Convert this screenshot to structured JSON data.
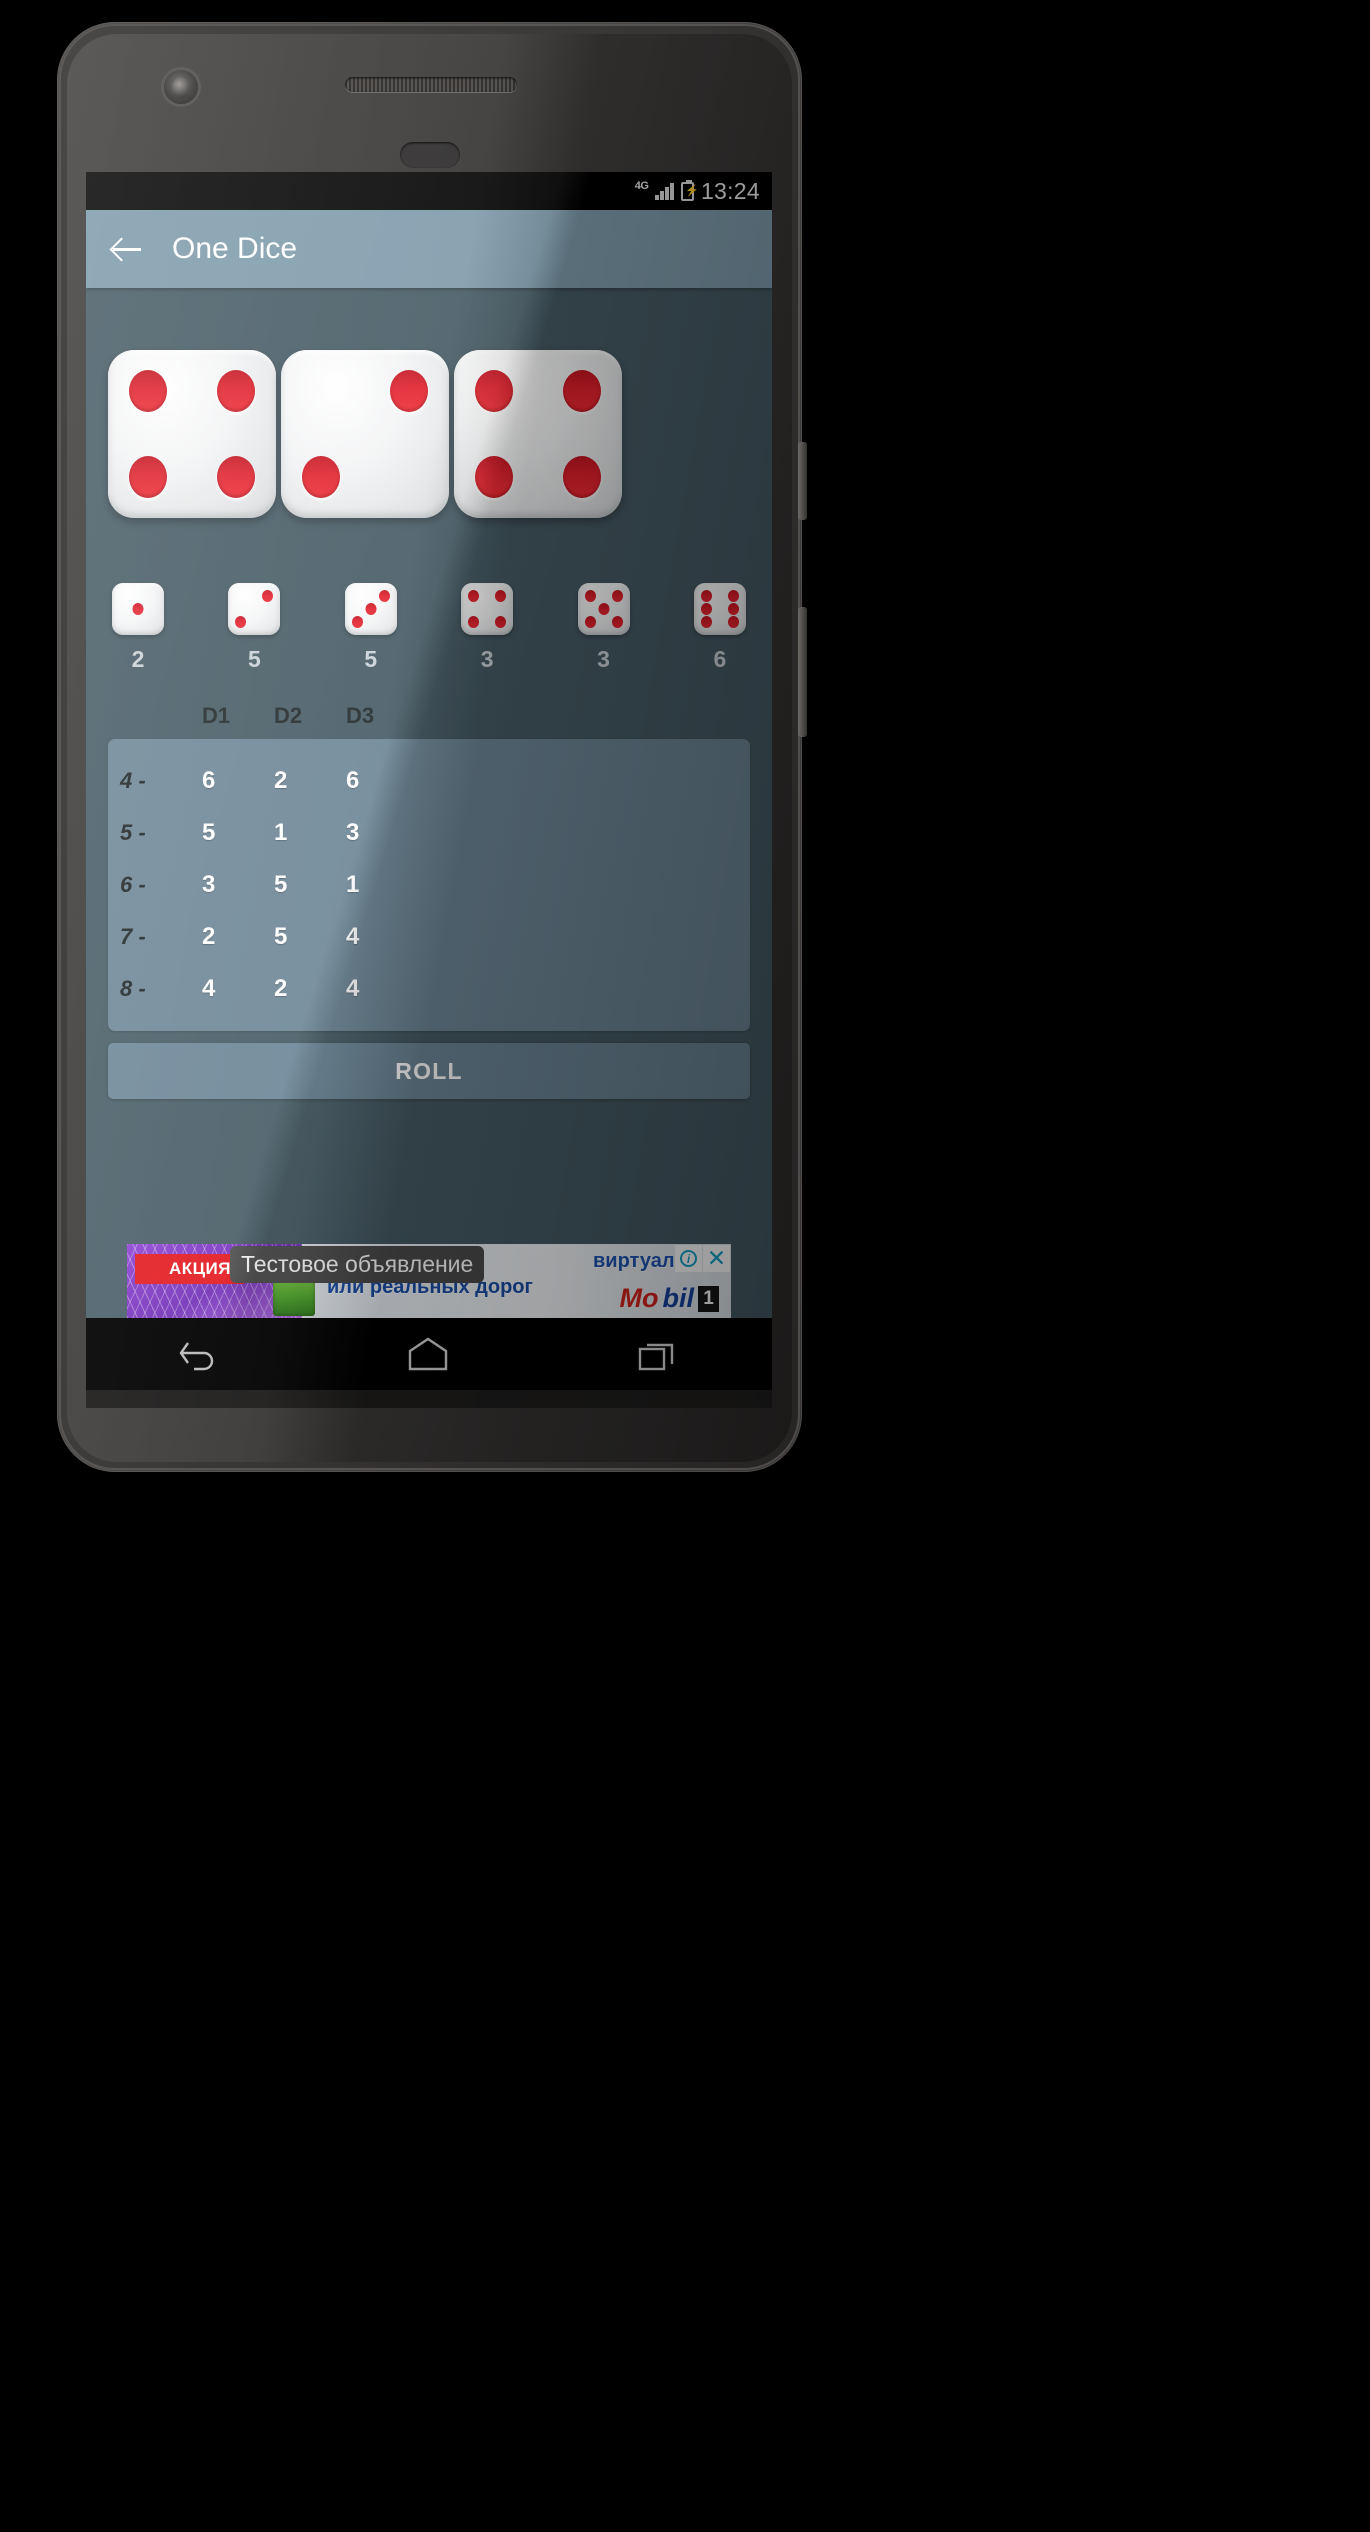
{
  "status_bar": {
    "network": "4G",
    "signal_icon": "signal-bars-icon",
    "battery_icon": "battery-charging-icon",
    "time": "13:24"
  },
  "toolbar": {
    "back_icon": "back-arrow-icon",
    "title": "One Dice"
  },
  "colors": {
    "app_background": "#455a64",
    "toolbar": "#7d9aaa",
    "panel": "#6c8595",
    "button": "#6a8495",
    "pip_red": "#e0202c",
    "die_white": "#f4f5f6",
    "text_light": "#ffffff",
    "text_dark": "#1b2224",
    "counter_label": "#c9d2d7",
    "ad_accent": "#14a3c7"
  },
  "current_roll": {
    "dice": [
      {
        "face": 4,
        "pips": [
          "tl",
          "tr",
          "bl",
          "br"
        ]
      },
      {
        "face": 2,
        "pips": [
          "tr",
          "bl"
        ]
      },
      {
        "face": 4,
        "pips": [
          "tl",
          "tr",
          "bl",
          "br"
        ]
      }
    ]
  },
  "face_counts": {
    "items": [
      {
        "face": 1,
        "pips": [
          "c"
        ],
        "count": "2"
      },
      {
        "face": 2,
        "pips": [
          "tr",
          "bl"
        ],
        "count": "5"
      },
      {
        "face": 3,
        "pips": [
          "tr",
          "c",
          "bl"
        ],
        "count": "5"
      },
      {
        "face": 4,
        "pips": [
          "tl",
          "tr",
          "bl",
          "br"
        ],
        "count": "3"
      },
      {
        "face": 5,
        "pips": [
          "tl",
          "tr",
          "c",
          "bl",
          "br"
        ],
        "count": "3"
      },
      {
        "face": 6,
        "pips": [
          "tl",
          "tr",
          "ml",
          "mr",
          "bl",
          "br"
        ],
        "count": "6"
      }
    ]
  },
  "history_table": {
    "row_label_header": "",
    "columns": [
      "D1",
      "D2",
      "D3"
    ],
    "rows": [
      {
        "label": "4 -",
        "values": [
          "6",
          "2",
          "6"
        ]
      },
      {
        "label": "5 -",
        "values": [
          "5",
          "1",
          "3"
        ]
      },
      {
        "label": "6 -",
        "values": [
          "3",
          "5",
          "1"
        ]
      },
      {
        "label": "7 -",
        "values": [
          "2",
          "5",
          "4"
        ]
      },
      {
        "label": "8 -",
        "values": [
          "4",
          "2",
          "4"
        ]
      }
    ]
  },
  "roll_button": {
    "label": "ROLL"
  },
  "ad_banner": {
    "badge": "АКЦИЯ",
    "overlay_text": "Тестовое объявление",
    "line_tail": "виртуаль",
    "line2": "или реальных дорог",
    "brand_mo": "Mo",
    "brand_bil": "bil",
    "brand_one": "1",
    "info_icon": "info-icon",
    "close_icon": "close-icon"
  },
  "nav_bar": {
    "back_icon": "nav-back-icon",
    "home_icon": "nav-home-icon",
    "recents_icon": "nav-recents-icon"
  },
  "device": {
    "camera_icon": "front-camera",
    "earpiece_icon": "earpiece-speaker",
    "sensor_icon": "proximity-sensor",
    "power_button": "power-button",
    "volume_button": "volume-button"
  }
}
